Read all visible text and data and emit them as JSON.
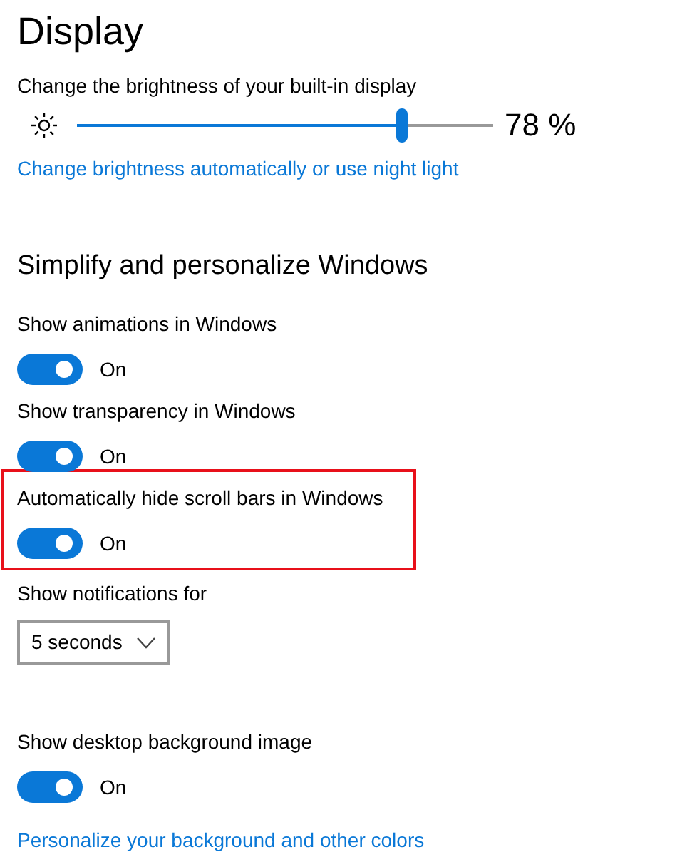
{
  "title": "Display",
  "brightness": {
    "label": "Change the brightness of your built-in display",
    "level": 0.78,
    "reading": "78 %"
  },
  "brightness_link": "Change brightness automatically or use night light",
  "section_title": "Simplify and personalize Windows",
  "settings": [
    {
      "kind": "toggle",
      "label": "Show animations in Windows",
      "on": true,
      "state_label": "On",
      "highlighted": false
    },
    {
      "kind": "toggle",
      "label": "Show transparency in Windows",
      "on": true,
      "state_label": "On",
      "highlighted": false
    },
    {
      "kind": "toggle",
      "label": "Automatically hide scroll bars in Windows",
      "on": true,
      "state_label": "On",
      "highlighted": true
    },
    {
      "kind": "dropdown",
      "label": "Show notifications for",
      "value": "5 seconds",
      "highlighted": false
    },
    {
      "kind": "toggle",
      "label": "Show desktop background image",
      "on": true,
      "state_label": "On",
      "highlighted": false
    }
  ],
  "footer_link": "Personalize your background and other colors"
}
